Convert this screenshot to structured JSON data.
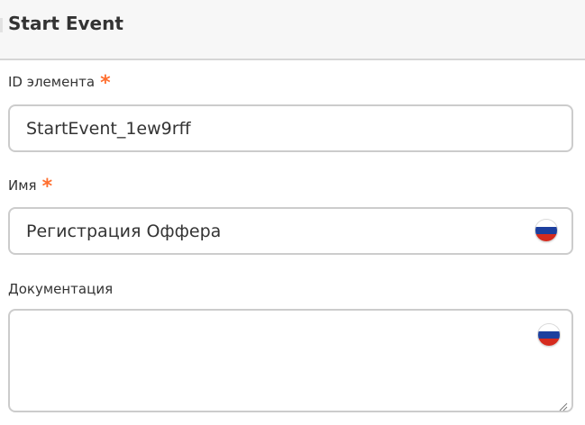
{
  "header": {
    "title": "Start Event"
  },
  "fields": {
    "element_id": {
      "label": "ID элемента",
      "required_mark": "*",
      "value": "StartEvent_1ew9rff"
    },
    "name": {
      "label": "Имя",
      "required_mark": "*",
      "value": "Регистрация Оффера",
      "language_icon": "russian-flag-icon"
    },
    "documentation": {
      "label": "Документация",
      "value": "",
      "language_icon": "russian-flag-icon"
    }
  },
  "colors": {
    "required": "#ff6e2e",
    "border": "#cccccc",
    "header_bg": "#f7f7f7",
    "flag_white": "#ffffff",
    "flag_blue": "#1c3f9e",
    "flag_red": "#d52b1e"
  }
}
